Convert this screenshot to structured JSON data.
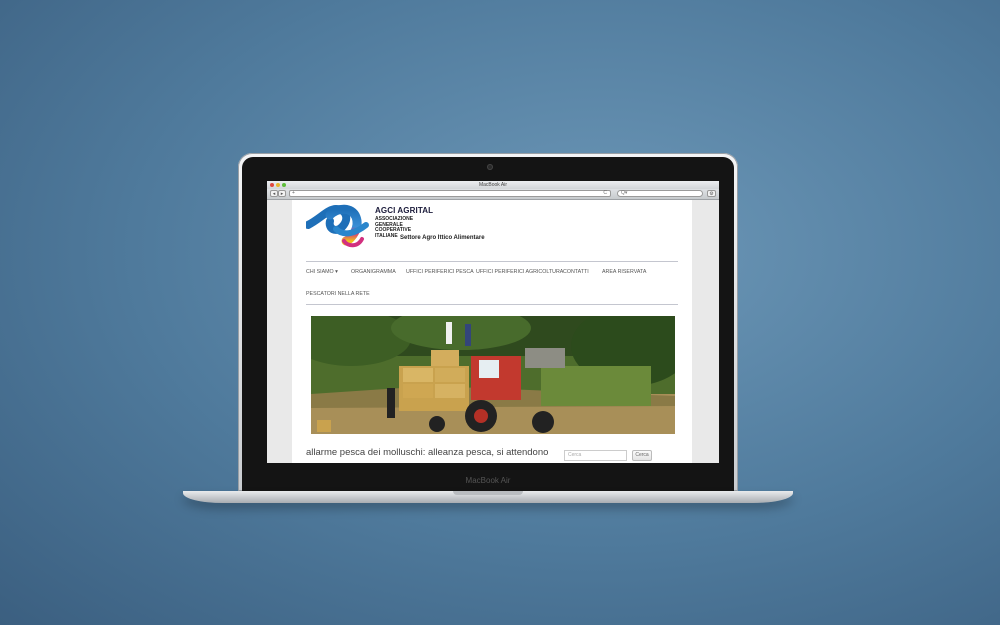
{
  "browser": {
    "window_title": "MacBook Air",
    "back_label": "◂",
    "forward_label": "▸",
    "add_label": "+",
    "url_text": "",
    "reload_label": "C",
    "search_placeholder": "Q▾",
    "action_label": "⚙"
  },
  "device": {
    "label": "MacBook Air"
  },
  "site": {
    "logo_title": "AGCI AGRITAL",
    "logo_subtitle": [
      "ASSOCIAZIONE",
      "GENERALE",
      "COOPERATIVE",
      "ITALIANE"
    ],
    "sector": "Settore Agro Ittico Alimentare",
    "menu": [
      {
        "label": "CHI SIAMO ▾"
      },
      {
        "label": "ORGANIGRAMMA"
      },
      {
        "label": "UFFICI PERIFERICI PESCA"
      },
      {
        "label": "UFFICI PERIFERICI AGRICOLTURA"
      },
      {
        "label": "CONTATTI"
      },
      {
        "label": "AREA RISERVATA"
      },
      {
        "label": "PESCATORI NELLA RETE"
      }
    ],
    "headline": "allarme pesca dei molluschi: alleanza pesca, si attendono",
    "search_placeholder": "Cerca",
    "search_button": "Cerca"
  },
  "colors": {
    "logo_blue": "#1e6fb8",
    "logo_magenta": "#d2307f",
    "logo_yellow": "#f1c21b"
  }
}
